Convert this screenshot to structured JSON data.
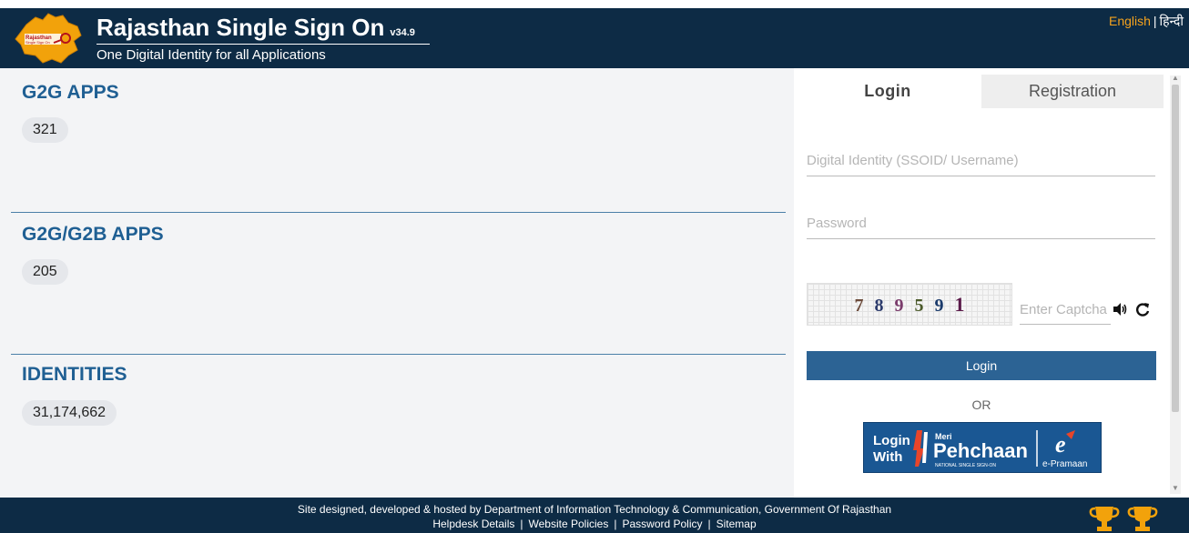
{
  "header": {
    "title": "Rajasthan Single Sign On",
    "version": "v34.9",
    "tagline": "One Digital Identity for all Applications",
    "logo_text_line1": "Rajasthan",
    "logo_text_line2": "Single Sign On",
    "lang_english": "English",
    "lang_separator": "|",
    "lang_hindi": "हिन्दी"
  },
  "stats": [
    {
      "title": "G2G APPS",
      "value": "321"
    },
    {
      "title": "G2G/G2B APPS",
      "value": "205"
    },
    {
      "title": "IDENTITIES",
      "value": "31,174,662"
    }
  ],
  "login_panel": {
    "tab_login": "Login",
    "tab_registration": "Registration",
    "username_placeholder": "Digital Identity (SSOID/ Username)",
    "password_placeholder": "Password",
    "captcha_digits": [
      "7",
      "8",
      "9",
      "5",
      "9",
      "1"
    ],
    "captcha_placeholder": "Enter Captcha",
    "login_button": "Login",
    "or_text": "OR",
    "pehchaan_login_with": "Login With",
    "pehchaan_meri": "Meri",
    "pehchaan_name": "Pehchaan",
    "pehchaan_sub": "NATIONAL SINGLE SIGN-ON",
    "epramaan": "e-Pramaan"
  },
  "footer": {
    "line1": "Site designed, developed & hosted by Department of Information Technology & Communication, Government Of Rajasthan",
    "links": [
      "Helpdesk Details",
      "Website Policies",
      "Password Policy",
      "Sitemap"
    ],
    "separator": "|"
  },
  "colors": {
    "header_bg": "#0d2b45",
    "section_title": "#1f5f93",
    "login_button": "#2c6394",
    "lang_english": "#f4a21d",
    "trophy": "#f2a20b"
  },
  "icons": [
    "rajasthan-map-logo-icon",
    "audio-icon",
    "refresh-icon",
    "trophy-icon"
  ]
}
